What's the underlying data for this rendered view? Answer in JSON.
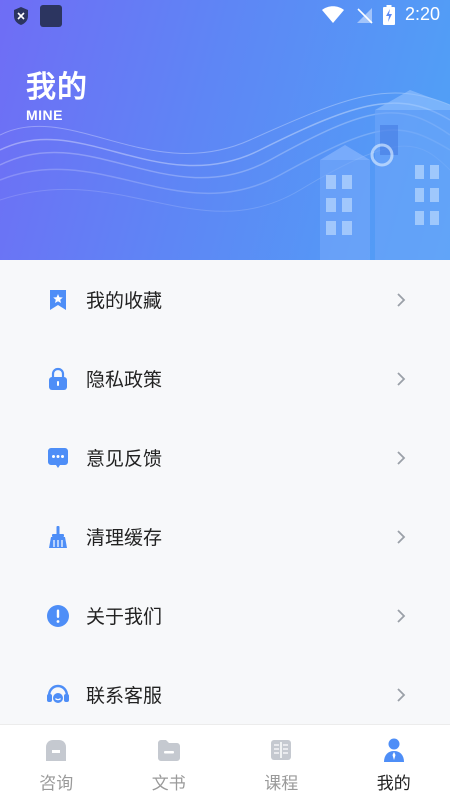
{
  "status_bar": {
    "time": "2:20"
  },
  "header": {
    "title": "我的",
    "subtitle": "MINE"
  },
  "menu": [
    {
      "label": "我的收藏",
      "icon": "bookmark-star-icon"
    },
    {
      "label": "隐私政策",
      "icon": "lock-icon"
    },
    {
      "label": "意见反馈",
      "icon": "chat-bubble-icon"
    },
    {
      "label": "清理缓存",
      "icon": "broom-icon"
    },
    {
      "label": "关于我们",
      "icon": "info-exclamation-icon"
    },
    {
      "label": "联系客服",
      "icon": "headset-icon"
    }
  ],
  "tabs": [
    {
      "label": "咨询",
      "icon": "home-a-icon",
      "active": false
    },
    {
      "label": "文书",
      "icon": "folder-icon",
      "active": false
    },
    {
      "label": "课程",
      "icon": "book-icon",
      "active": false
    },
    {
      "label": "我的",
      "icon": "user-icon",
      "active": true
    }
  ],
  "colors": {
    "accent": "#4e8ef7",
    "hero_start": "#6f6df5",
    "hero_end": "#4fa3f6",
    "inactive": "#c5c9d0"
  }
}
